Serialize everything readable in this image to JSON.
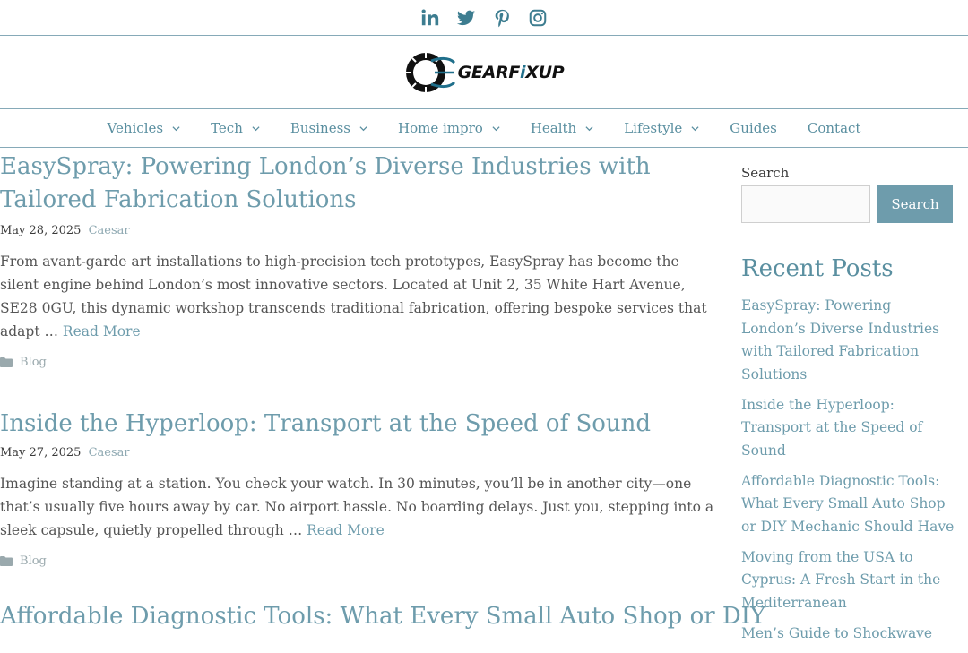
{
  "social": {
    "icons": [
      "linkedin-icon",
      "twitter-icon",
      "pinterest-icon",
      "instagram-icon"
    ],
    "color": "#3d7d90"
  },
  "brand": {
    "logo_text_1": "GEAR",
    "logo_text_2": "F",
    "logo_text_3": "XUP"
  },
  "nav": {
    "items": [
      {
        "label": "Vehicles",
        "dropdown": true
      },
      {
        "label": "Tech",
        "dropdown": true
      },
      {
        "label": "Business",
        "dropdown": true
      },
      {
        "label": "Home impro",
        "dropdown": true
      },
      {
        "label": "Health",
        "dropdown": true
      },
      {
        "label": "Lifestyle",
        "dropdown": true
      },
      {
        "label": "Guides",
        "dropdown": false
      },
      {
        "label": "Contact",
        "dropdown": false
      }
    ]
  },
  "posts": [
    {
      "title": "EasySpray: Powering London’s Diverse Industries with Tailored Fabrication Solutions",
      "date": "May 28, 2025",
      "author": "Caesar",
      "excerpt": "From avant-garde art installations to high-precision tech prototypes, EasySpray has become the silent engine behind London’s most innovative sectors. Located at Unit 2, 35 White Hart Avenue, SE28 0GU, this dynamic workshop transcends traditional fabrication, offering bespoke services that adapt … ",
      "read_more": "Read More",
      "category": "Blog"
    },
    {
      "title": "Inside the Hyperloop: Transport at the Speed of Sound",
      "date": "May 27, 2025",
      "author": "Caesar",
      "excerpt": "Imagine standing at a station. You check your watch. In 30 minutes, you’ll be in another city—one that’s usually five hours away by car. No airport hassle. No boarding delays. Just you, stepping into a sleek capsule, quietly propelled through … ",
      "read_more": "Read More",
      "category": "Blog"
    },
    {
      "title": "Affordable Diagnostic Tools: What Every Small Auto Shop or DIY"
    }
  ],
  "sidebar": {
    "search_label": "Search",
    "search_value": "",
    "search_button": "Search",
    "recent_heading": "Recent Posts",
    "recent_posts": [
      "EasySpray: Powering London’s Diverse Industries with Tailored Fabrication Solutions",
      "Inside the Hyperloop: Transport at the Speed of Sound",
      "Affordable Diagnostic Tools: What Every Small Auto Shop or DIY Mechanic Should Have",
      "Moving from the USA to Cyprus: A Fresh Start in the Mediterranean",
      "Men’s Guide to Shockwave"
    ]
  },
  "colors": {
    "accent": "#6e9cac",
    "border": "#86aab8",
    "social": "#3d7d90"
  }
}
